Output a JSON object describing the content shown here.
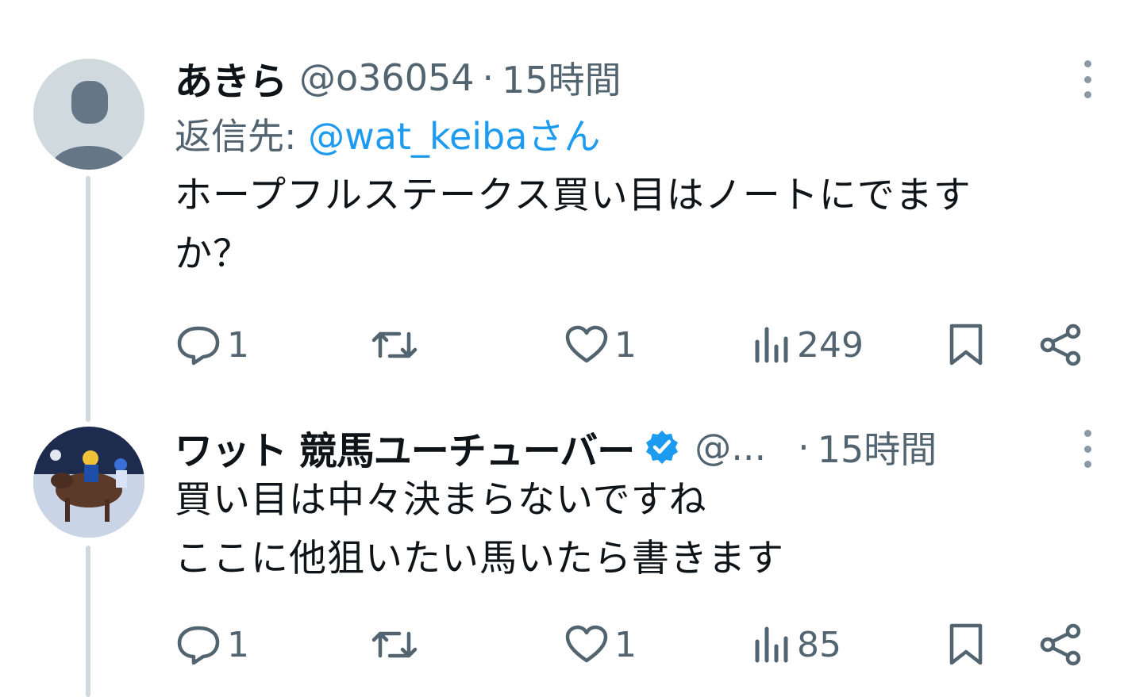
{
  "tweets": [
    {
      "name": "あきら",
      "handle": "@o36054",
      "dot": "·",
      "time": "15時間",
      "reply_prefix": "返信先: ",
      "reply_mention": "@wat_keibaさん",
      "text_line1": "ホープフルステークス買い目はノートにでます",
      "text_line2": "か？",
      "replies": "1",
      "retweets": "",
      "likes": "1",
      "views": "249",
      "avatar_icon": "default-profile-icon"
    },
    {
      "name": "ワット 競馬ユーチューバー",
      "handle": "@...",
      "dot": "·",
      "time": "15時間",
      "verified": true,
      "text_line1": "買い目は中々決まらないですね",
      "text_line2": "ここに他狙いたい馬いたら書きます",
      "replies": "1",
      "retweets": "",
      "likes": "1",
      "views": "85",
      "avatar_icon": "horse-racing-photo"
    }
  ],
  "colors": {
    "text": "#0f1419",
    "secondary": "#536471",
    "link": "#1d9bf0",
    "thread_line": "#cfd9de"
  }
}
